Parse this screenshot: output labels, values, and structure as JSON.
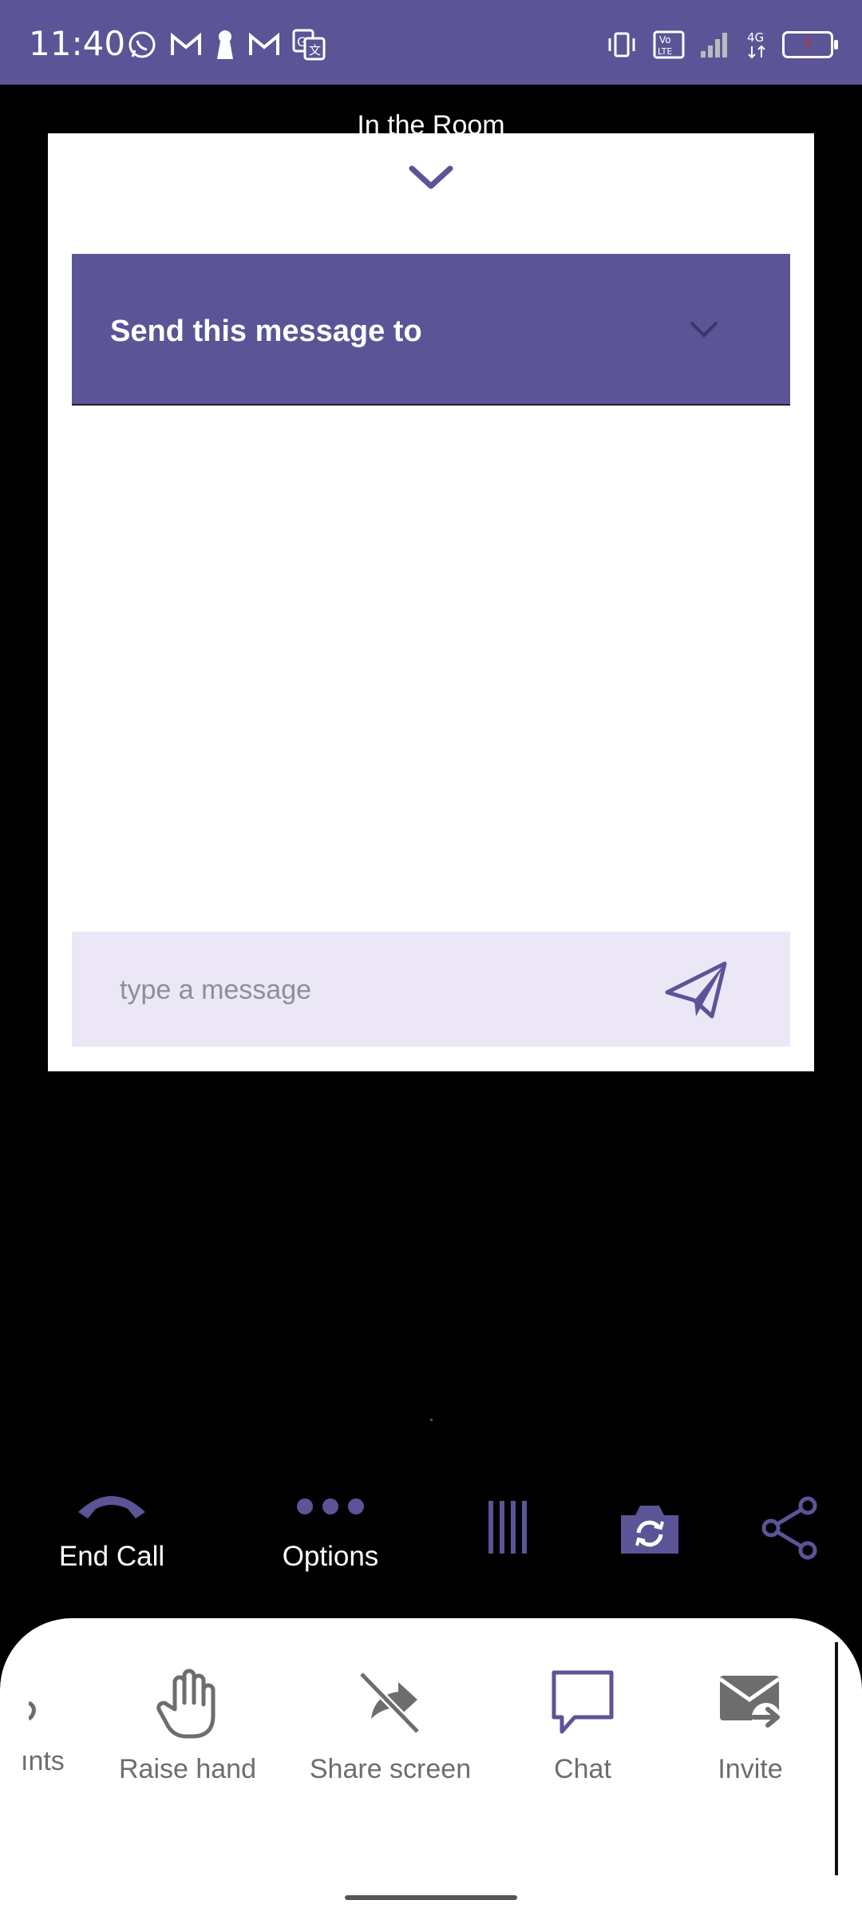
{
  "status_bar": {
    "time": "11:40",
    "left_icons": [
      "whatsapp-icon",
      "gmail-icon",
      "keyhole-icon",
      "gmail-icon",
      "translate-icon"
    ],
    "right_icons": [
      "vibrate-icon",
      "volte-icon",
      "signal-icon",
      "4g-icon",
      "battery-icon"
    ],
    "battery_level": "7"
  },
  "room": {
    "title": "In the Room"
  },
  "chat_sheet": {
    "recipient_label": "Send this message to",
    "input_placeholder": "type a message",
    "input_value": ""
  },
  "call_bar": {
    "end_call_label": "End Call",
    "options_label": "Options",
    "icons": [
      "phone-end-icon",
      "more-dots-icon",
      "layout-icon",
      "switch-camera-icon",
      "share-icon"
    ]
  },
  "tray": {
    "items": [
      {
        "label": "ınts",
        "icon": "participants-icon"
      },
      {
        "label": "Raise hand",
        "icon": "hand-icon"
      },
      {
        "label": "Share screen",
        "icon": "screen-share-off-icon"
      },
      {
        "label": "Chat",
        "icon": "chat-icon"
      },
      {
        "label": "Invite",
        "icon": "invite-icon"
      }
    ]
  },
  "colors": {
    "accent": "#5b5497",
    "composer_bg": "#ebe7f6",
    "tray_icon": "#6d6d6d"
  }
}
